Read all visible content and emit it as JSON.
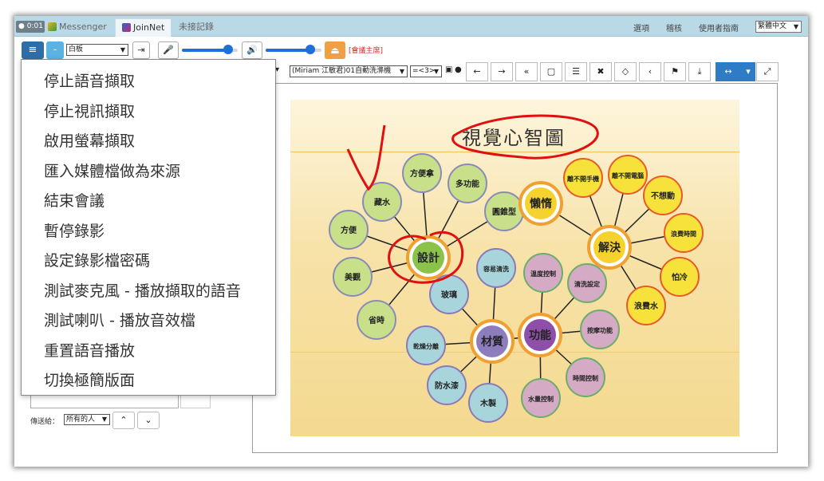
{
  "topbar": {
    "timer": "0:01",
    "tabs": [
      {
        "label": "Messenger",
        "active": false
      },
      {
        "label": "JoinNet",
        "active": true
      },
      {
        "label": "未接記錄",
        "active": false
      }
    ],
    "links": {
      "options": "選項",
      "review": "稽核",
      "guide": "使用者指南"
    },
    "language": "繁體中文"
  },
  "toolbar": {
    "menu_icon": "≡",
    "minus_label": "-",
    "whiteboard_select": "白板",
    "host_label": "[會議主席]",
    "mic_level": 0.85,
    "speaker_level": 0.8
  },
  "viewer": {
    "page_select": "(Miriam 江敏君)01自動洗滌機",
    "zoom_select": "=<3>"
  },
  "slide": {
    "title": "視覺心智圖",
    "center_nodes": [
      {
        "id": "design",
        "label": "設計",
        "color": "#8bc34a"
      },
      {
        "id": "solve",
        "label": "解決",
        "color": "#f6d22e"
      },
      {
        "id": "lazy",
        "label": "懶惰",
        "color": "#f6d22e"
      },
      {
        "id": "material",
        "label": "材質",
        "color": "#8e7dbd"
      },
      {
        "id": "function",
        "label": "功能",
        "color": "#8e4fa8"
      }
    ],
    "nodes": [
      {
        "label": "方便拿",
        "group": "green",
        "parent": "design"
      },
      {
        "label": "多功能",
        "group": "green",
        "parent": "design"
      },
      {
        "label": "藏水",
        "group": "green",
        "parent": "design"
      },
      {
        "label": "圓錐型",
        "group": "green",
        "parent": "design"
      },
      {
        "label": "方便",
        "group": "green",
        "parent": "design"
      },
      {
        "label": "美觀",
        "group": "green",
        "parent": "design"
      },
      {
        "label": "省時",
        "group": "green",
        "parent": "design"
      },
      {
        "label": "離不開手機",
        "group": "yellow",
        "parent": "solve"
      },
      {
        "label": "離不開電腦",
        "group": "yellow",
        "parent": "solve"
      },
      {
        "label": "不想動",
        "group": "yellow",
        "parent": "solve"
      },
      {
        "label": "浪費時間",
        "group": "yellow",
        "parent": "solve"
      },
      {
        "label": "怕冷",
        "group": "yellow",
        "parent": "solve"
      },
      {
        "label": "浪費水",
        "group": "yellow",
        "parent": "solve"
      },
      {
        "label": "玻璃",
        "group": "teal",
        "parent": "material"
      },
      {
        "label": "容易清洗",
        "group": "teal",
        "parent": "material"
      },
      {
        "label": "乾燥分離",
        "group": "teal",
        "parent": "material"
      },
      {
        "label": "防水漆",
        "group": "teal",
        "parent": "material"
      },
      {
        "label": "木製",
        "group": "teal",
        "parent": "material"
      },
      {
        "label": "溫度控制",
        "group": "pink",
        "parent": "function"
      },
      {
        "label": "清洗設定",
        "group": "pink",
        "parent": "function"
      },
      {
        "label": "按摩功能",
        "group": "pink",
        "parent": "function"
      },
      {
        "label": "時間控制",
        "group": "pink",
        "parent": "function"
      },
      {
        "label": "水量控制",
        "group": "pink",
        "parent": "function"
      }
    ]
  },
  "chat": {
    "send_to_label": "傳送給：",
    "recipient": "所有的人"
  },
  "menu": {
    "items": [
      "停止語音擷取",
      "停止視訊擷取",
      "啟用螢幕擷取",
      "匯入媒體檔做為來源",
      "結束會議",
      "暫停錄影",
      "設定錄影檔密碼",
      "測試麥克風 - 播放擷取的語音",
      "測試喇叭 - 播放音效檔",
      "重置語音播放",
      "切換極簡版面"
    ]
  },
  "colors": {
    "topbar": "#b9d9e6",
    "primary": "#2f6da8",
    "accent": "#f0a043",
    "slider": "#1e6fd9",
    "annotation": "#e01010"
  }
}
